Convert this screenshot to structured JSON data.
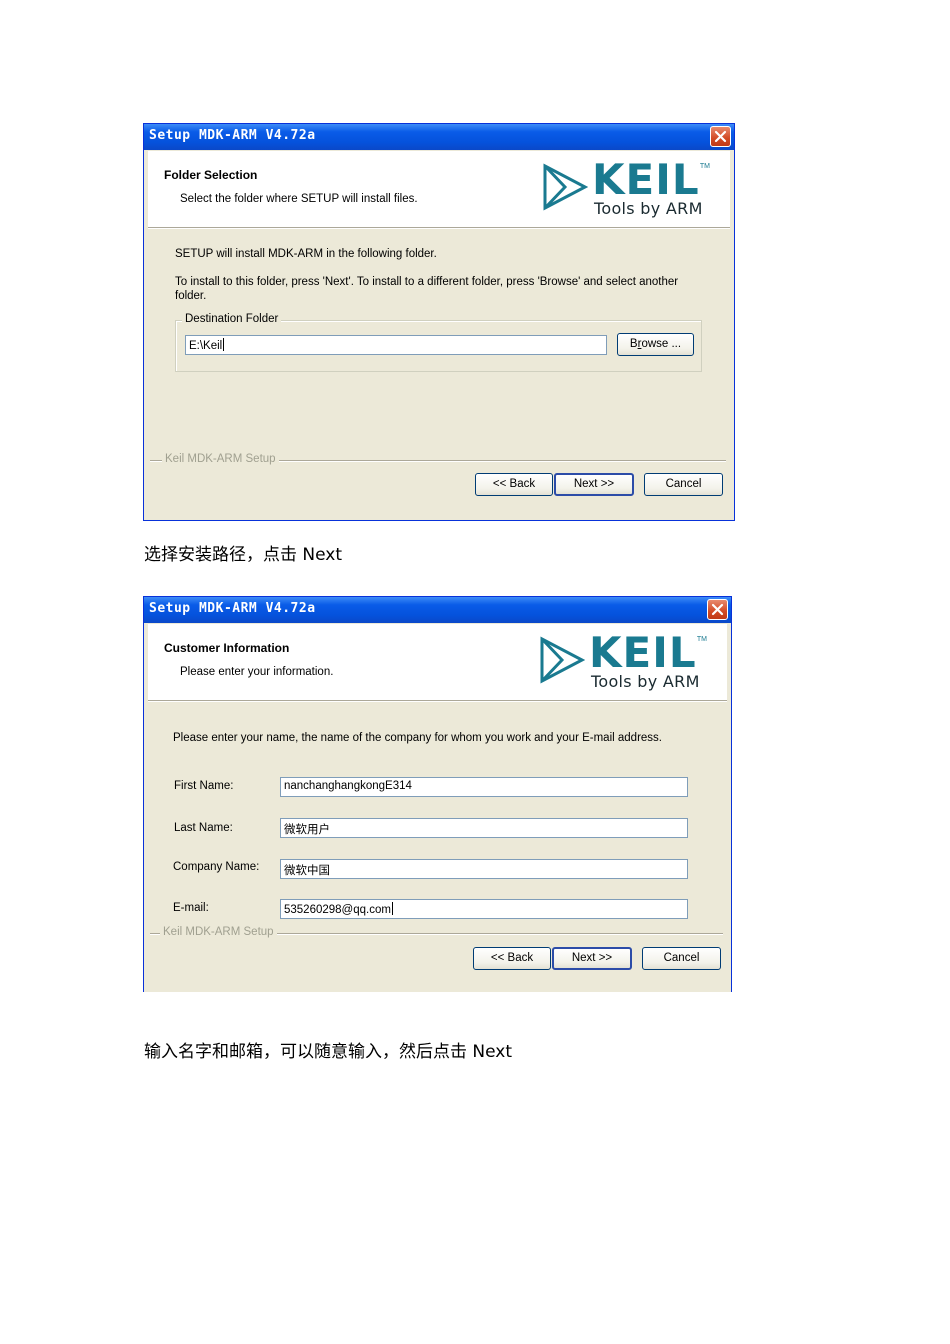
{
  "dialog1": {
    "title": "Setup MDK-ARM V4.72a",
    "header_title": "Folder Selection",
    "header_subtitle": "Select the folder where SETUP will install files.",
    "logo": {
      "brand": "KEIL",
      "tm": "TM",
      "tagline": "Tools by ARM"
    },
    "body_line1": "SETUP will install MDK-ARM in the following folder.",
    "body_line2": "To install to this folder, press 'Next'. To install to a different folder, press 'Browse' and select another",
    "body_line3": "folder.",
    "group_label": "Destination Folder",
    "folder_value": "E:\\Keil",
    "browse_label_pre": "B",
    "browse_label_ul": "r",
    "browse_label_post": "owse ...",
    "footer_label": "Keil MDK-ARM Setup",
    "back_label": "<< Back",
    "next_label": "Next >>",
    "cancel_label": "Cancel"
  },
  "caption1": "选择安装路径，点击 Next",
  "dialog2": {
    "title": "Setup MDK-ARM V4.72a",
    "header_title": "Customer Information",
    "header_subtitle": "Please enter your information.",
    "logo": {
      "brand": "KEIL",
      "tm": "TM",
      "tagline": "Tools by ARM"
    },
    "body_line1": "Please enter your name, the name of the company for whom you work and your E-mail address.",
    "fields": [
      {
        "label": "First Name:",
        "value": "nanchanghangkongE314"
      },
      {
        "label": "Last Name:",
        "value": "微软用户"
      },
      {
        "label": "Company Name:",
        "value": "微软中国"
      },
      {
        "label": "E-mail:",
        "value": "535260298@qq.com"
      }
    ],
    "footer_label": "Keil MDK-ARM Setup",
    "back_label": "<< Back",
    "next_label": "Next >>",
    "cancel_label": "Cancel"
  },
  "caption2": "输入名字和邮箱，可以随意输入，然后点击 Next",
  "colors": {
    "titlebar": "#0a5ce8",
    "dialog_bg": "#ece9d8",
    "keil_teal": "#1a7a90",
    "close_red": "#d24a24"
  },
  "icons": [
    "close-icon",
    "keil-logo-icon"
  ]
}
